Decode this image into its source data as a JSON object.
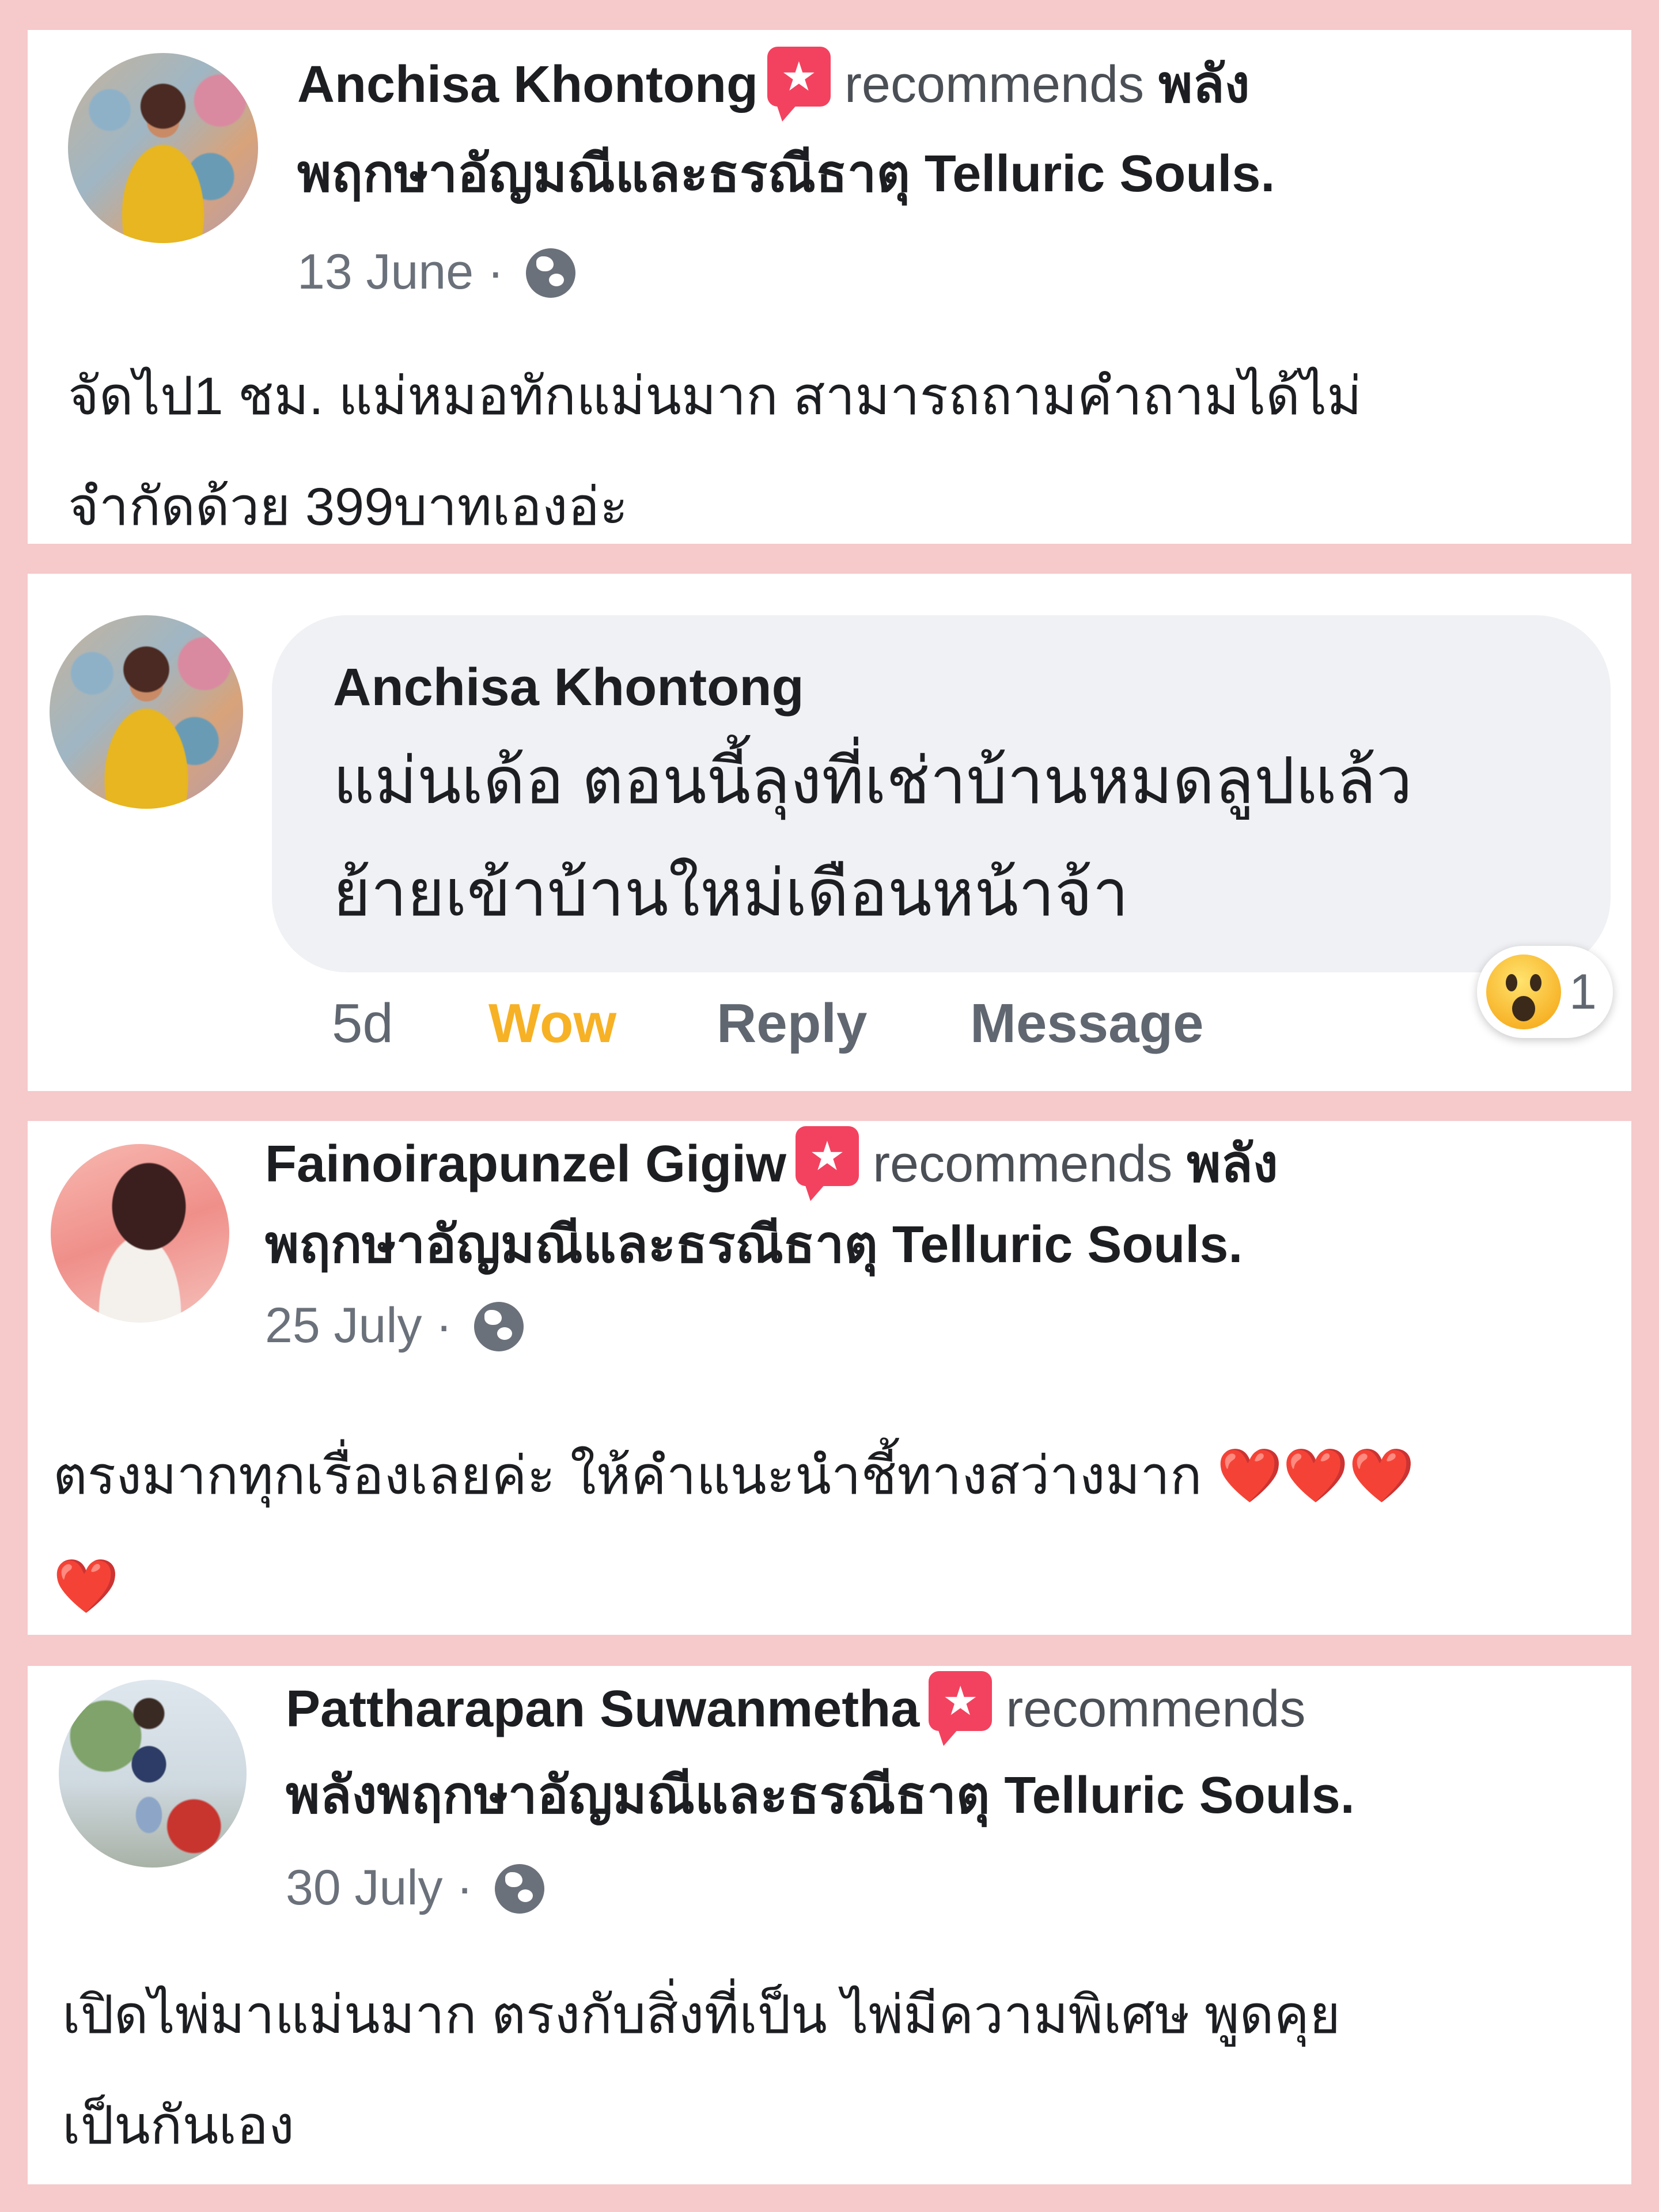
{
  "reviews": [
    {
      "reviewer": "Anchisa Khontong",
      "recommends": "recommends",
      "page_first": "พลัง",
      "page_rest": "พฤกษาอัญมณีและธรณีธาตุ Telluric Souls.",
      "date": "13 June",
      "separator": "·",
      "text_line1": "จัดไป1 ชม. แม่หมอทักแม่นมาก สามารถถามคำถามได้ไม่",
      "text_line2": "จำกัดด้วย 399บาทเองอ่ะ"
    },
    {
      "reviewer": "Fainoirapunzel Gigiw",
      "recommends": "recommends",
      "page_first": "พลัง",
      "page_rest": "พฤกษาอัญมณีและธรณีธาตุ Telluric Souls.",
      "date": "25 July",
      "separator": "·",
      "text_line1": "ตรงมากทุกเรื่องเลยค่ะ ให้คำแนะนำชี้ทางสว่างมาก",
      "hearts_line1": "❤️❤️❤️",
      "hearts_line2": "❤️"
    },
    {
      "reviewer": "Pattharapan Suwanmetha",
      "recommends": "recommends",
      "page_full": "พลังพฤกษาอัญมณีและธรณีธาตุ Telluric Souls.",
      "date": "30 July",
      "separator": "·",
      "text_line1": "เปิดไพ่มาแม่นมาก ตรงกับสิ่งที่เป็น ไพ่มีความพิเศษ พูดคุย",
      "text_line2": "เป็นกันเอง"
    }
  ],
  "comment": {
    "author": "Anchisa Khontong",
    "text_line1": "แม่นเด้อ ตอนนี้ลุงที่เช่าบ้านหมดลูปแล้ว",
    "text_line2": "ย้ายเข้าบ้านใหม่เดือนหน้าจ้า",
    "time": "5d",
    "reaction_label": "Wow",
    "reply_label": "Reply",
    "message_label": "Message",
    "reaction_count": "1"
  },
  "icons": {
    "recommend": "recommend-star-icon",
    "audience": "globe-icon",
    "reaction": "wow-emoji-icon"
  },
  "colors": {
    "background": "#f6c9cb",
    "recommend_badge": "#f3425f",
    "wow": "#f7b125",
    "heart": "#e0242b"
  }
}
